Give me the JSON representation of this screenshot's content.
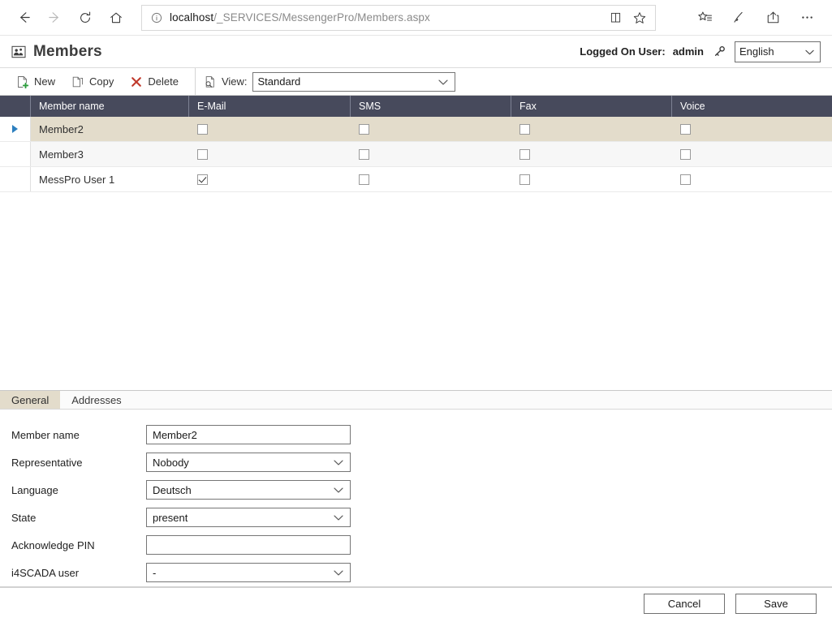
{
  "browser": {
    "back_icon": "arrow-left-icon",
    "forward_icon": "arrow-right-icon",
    "refresh_icon": "refresh-icon",
    "home_icon": "home-icon",
    "info_icon": "info-circle-icon",
    "url_host": "localhost",
    "url_path": "/_SERVICES/MessengerPro/Members.aspx",
    "reading_view_icon": "book-icon",
    "favorite_icon": "star-icon",
    "hub_icon": "hub-favorites-icon",
    "notes_icon": "web-notes-icon",
    "share_icon": "share-icon",
    "more_icon": "more-ellipsis-icon"
  },
  "header": {
    "title": "Members",
    "title_icon": "members-group-icon",
    "logged_label": "Logged On User:",
    "logged_user": "admin",
    "key_icon": "key-icon",
    "language_value": "English",
    "language_chevron": "chevron-down-icon"
  },
  "toolbar": {
    "new_label": "New",
    "new_icon": "new-document-icon",
    "copy_label": "Copy",
    "copy_icon": "copy-document-icon",
    "delete_label": "Delete",
    "delete_icon": "delete-x-icon",
    "view_icon": "view-document-icon",
    "view_label": "View:",
    "view_value": "Standard",
    "view_chevron": "chevron-down-icon"
  },
  "grid": {
    "columns": [
      "",
      "Member name",
      "E-Mail",
      "SMS",
      "Fax",
      "Voice"
    ],
    "rows": [
      {
        "selected": true,
        "name": "Member2",
        "email": false,
        "sms": false,
        "fax": false,
        "voice": false
      },
      {
        "selected": false,
        "name": "Member3",
        "email": false,
        "sms": false,
        "fax": false,
        "voice": false
      },
      {
        "selected": false,
        "name": "MessPro User 1",
        "email": true,
        "sms": false,
        "fax": false,
        "voice": false
      }
    ]
  },
  "detail": {
    "tabs": [
      {
        "label": "General",
        "active": true
      },
      {
        "label": "Addresses",
        "active": false
      }
    ],
    "fields": [
      {
        "label": "Member name",
        "value": "Member2",
        "type": "text"
      },
      {
        "label": "Representative",
        "value": "Nobody",
        "type": "select"
      },
      {
        "label": "Language",
        "value": "Deutsch",
        "type": "select"
      },
      {
        "label": "State",
        "value": "present",
        "type": "select"
      },
      {
        "label": "Acknowledge PIN",
        "value": "",
        "type": "text"
      },
      {
        "label": "i4SCADA user",
        "value": "-",
        "type": "select"
      }
    ]
  },
  "footer": {
    "cancel_label": "Cancel",
    "save_label": "Save"
  },
  "colors": {
    "grid_header_bg": "#474A5C",
    "selected_row_bg": "#E3DCCB",
    "alt_row_bg": "#F7F7F7",
    "selector_triangle": "#2C7FBF",
    "delete_icon": "#C0392B",
    "new_plus": "#2E9E3E"
  }
}
